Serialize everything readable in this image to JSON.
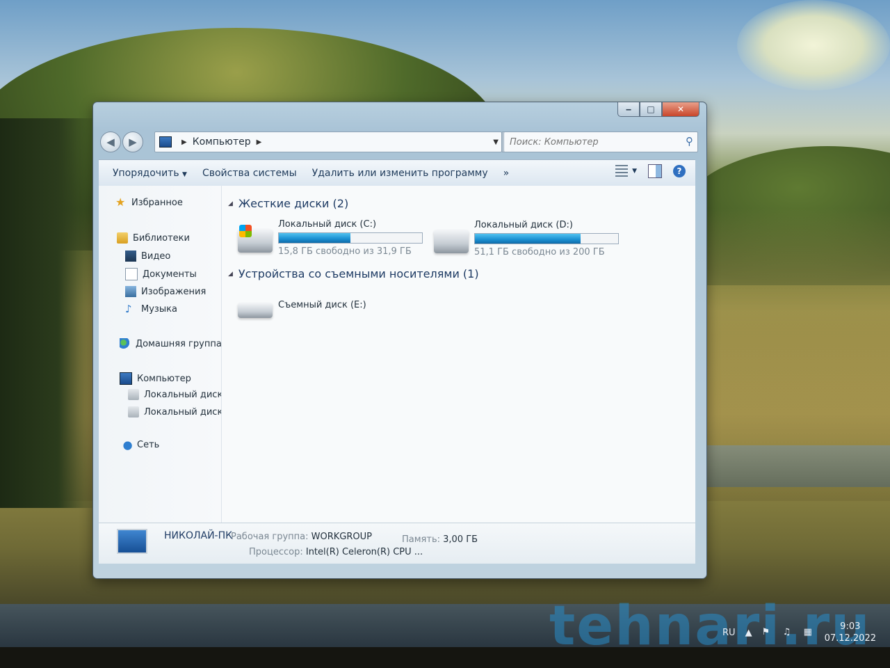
{
  "window": {
    "title_buttons": {
      "minimize": "‒",
      "maximize": "□",
      "close": "✕"
    },
    "address": {
      "path": "Компьютер"
    },
    "search": {
      "placeholder": "Поиск: Компьютер"
    }
  },
  "toolbar": {
    "organize": "Упорядочить",
    "system_properties": "Свойства системы",
    "uninstall": "Удалить или изменить программу",
    "more": "»"
  },
  "nav": {
    "favorites": "Избранное",
    "libraries": "Библиотеки",
    "video": "Видео",
    "documents": "Документы",
    "images": "Изображения",
    "music": "Музыка",
    "homegroup": "Домашняя группа",
    "computer": "Компьютер",
    "drive_c": "Локальный диск (C",
    "drive_d": "Локальный диск (D",
    "network": "Сеть"
  },
  "content": {
    "hard_drives_header": "Жесткие диски (2)",
    "removable_header": "Устройства со съемными носителями (1)",
    "drives": [
      {
        "name": "Локальный диск (C:)",
        "free_text": "15,8 ГБ свободно из 31,9 ГБ",
        "used_fraction": 0.5
      },
      {
        "name": "Локальный диск (D:)",
        "free_text": "51,1 ГБ свободно из 200 ГБ",
        "used_fraction": 0.74
      }
    ],
    "removable": [
      {
        "name": "Съемный диск (E:)"
      }
    ]
  },
  "details": {
    "computer_name": "НИКОЛАЙ-ПК",
    "workgroup_label": "Рабочая группа:",
    "workgroup_value": "WORKGROUP",
    "memory_label": "Память:",
    "memory_value": "3,00 ГБ",
    "cpu_label": "Процессор:",
    "cpu_value": "Intel(R) Celeron(R) CPU ..."
  },
  "taskbar": {
    "lang": "RU",
    "time": "9:03",
    "date": "07.12.2022",
    "watermark": "tehnari.ru"
  },
  "colors": {
    "accent": "#1a8fd1",
    "title_text": "#1d3a63"
  }
}
